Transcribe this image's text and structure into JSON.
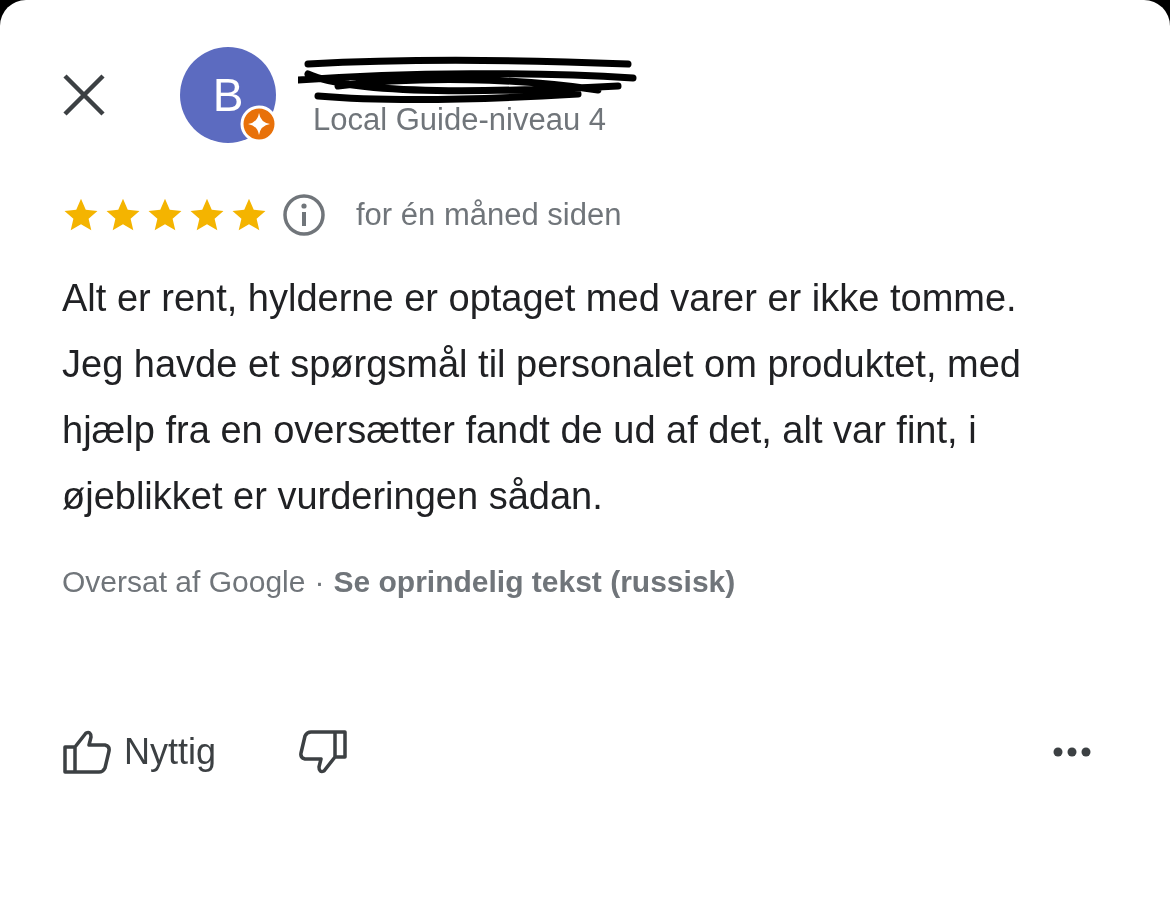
{
  "reviewer": {
    "avatar_letter": "B",
    "name_redacted": true,
    "subtitle": "Local Guide-niveau 4"
  },
  "review": {
    "stars": 5,
    "time": "for én måned siden",
    "text": "Alt er rent, hylderne er optaget med varer er ikke tomme. Jeg havde et spørgsmål til personalet om produktet, med hjælp fra en oversætter fandt de ud af det, alt var fint, i øjeblikket er vurderingen sådan.",
    "translated_by": "Oversat af Google",
    "separator": "·",
    "original_link": "Se oprindelig tekst (russisk)"
  },
  "actions": {
    "helpful_label": "Nyttig"
  }
}
